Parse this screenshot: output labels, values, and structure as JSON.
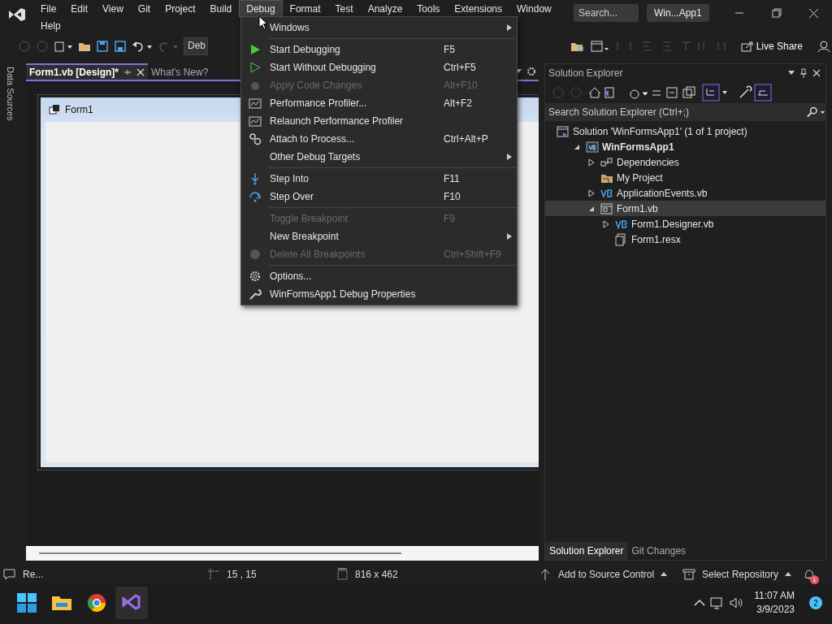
{
  "menu_bar": {
    "items": [
      {
        "label": "File",
        "selected": false
      },
      {
        "label": "Edit",
        "selected": false
      },
      {
        "label": "View",
        "selected": false
      },
      {
        "label": "Git",
        "selected": false
      },
      {
        "label": "Project",
        "selected": false
      },
      {
        "label": "Build",
        "selected": false
      },
      {
        "label": "Debug",
        "selected": true
      },
      {
        "label": "Format",
        "selected": false
      },
      {
        "label": "Test",
        "selected": false
      },
      {
        "label": "Analyze",
        "selected": false
      },
      {
        "label": "Tools",
        "selected": false
      },
      {
        "label": "Extensions",
        "selected": false
      },
      {
        "label": "Window",
        "selected": false
      },
      {
        "label": "Help",
        "selected": false
      }
    ],
    "search": {
      "placeholder": "Search..."
    },
    "solution_name": "Win...App1"
  },
  "toolbar": {
    "configuration": "Deb",
    "live_share": "Live Share"
  },
  "side_tab": "Data Sources",
  "doc_tabs": [
    {
      "label": "Form1.vb [Design]*",
      "selected": true
    },
    {
      "label": "What's New?",
      "selected": false
    }
  ],
  "designer": {
    "form_title": "Form1"
  },
  "debug_menu": [
    {
      "kind": "item",
      "label": "Windows",
      "disabled": false,
      "submenu": true
    },
    {
      "kind": "separator"
    },
    {
      "kind": "item",
      "label": "Start Debugging",
      "shortcut": "F5",
      "disabled": false,
      "submenu": false
    },
    {
      "kind": "item",
      "label": "Start Without Debugging",
      "shortcut": "Ctrl+F5",
      "disabled": false,
      "submenu": false
    },
    {
      "kind": "item",
      "label": "Apply Code Changes",
      "shortcut": "Alt+F10",
      "disabled": true,
      "submenu": false
    },
    {
      "kind": "item",
      "label": "Performance Profiler...",
      "shortcut": "Alt+F2",
      "disabled": false,
      "submenu": false
    },
    {
      "kind": "item",
      "label": "Relaunch Performance Profiler",
      "disabled": false,
      "submenu": false
    },
    {
      "kind": "item",
      "label": "Attach to Process...",
      "shortcut": "Ctrl+Alt+P",
      "disabled": false,
      "submenu": false
    },
    {
      "kind": "item",
      "label": "Other Debug Targets",
      "disabled": false,
      "submenu": true
    },
    {
      "kind": "separator"
    },
    {
      "kind": "item",
      "label": "Step Into",
      "shortcut": "F11",
      "disabled": false,
      "submenu": false
    },
    {
      "kind": "item",
      "label": "Step Over",
      "shortcut": "F10",
      "disabled": false,
      "submenu": false
    },
    {
      "kind": "separator"
    },
    {
      "kind": "item",
      "label": "Toggle Breakpoint",
      "shortcut": "F9",
      "disabled": true,
      "submenu": false
    },
    {
      "kind": "item",
      "label": "New Breakpoint",
      "disabled": false,
      "submenu": true
    },
    {
      "kind": "item",
      "label": "Delete All Breakpoints",
      "shortcut": "Ctrl+Shift+F9",
      "disabled": true,
      "submenu": false
    },
    {
      "kind": "separator"
    },
    {
      "kind": "item",
      "label": "Options...",
      "disabled": false,
      "submenu": false
    },
    {
      "kind": "item",
      "label": "WinFormsApp1 Debug Properties",
      "disabled": false,
      "submenu": false
    }
  ],
  "solution_explorer": {
    "title": "Solution Explorer",
    "search": {
      "placeholder": "Search Solution Explorer (Ctrl+;)"
    },
    "tree": [
      {
        "kind": "solution",
        "label": "Solution 'WinFormsApp1' (1 of 1 project)",
        "selected": false,
        "children": [
          {
            "kind": "project",
            "label": "WinFormsApp1",
            "expanded": true,
            "selected": false,
            "children": [
              {
                "kind": "dependencies",
                "label": "Dependencies",
                "expanded": false,
                "selected": false
              },
              {
                "kind": "myproject",
                "label": "My Project",
                "selected": false
              },
              {
                "kind": "vb",
                "label": "ApplicationEvents.vb",
                "expanded": false,
                "selected": false
              },
              {
                "kind": "form",
                "label": "Form1.vb",
                "expanded": true,
                "selected": true,
                "children": [
                  {
                    "kind": "vb",
                    "label": "Form1.Designer.vb",
                    "expanded": false,
                    "selected": false
                  },
                  {
                    "kind": "resx",
                    "label": "Form1.resx",
                    "selected": false
                  }
                ]
              }
            ]
          }
        ]
      }
    ],
    "tabs": [
      {
        "label": "Solution Explorer",
        "selected": true
      },
      {
        "label": "Git Changes",
        "selected": false
      }
    ]
  },
  "status_bar": {
    "message": "Re...",
    "position": "15 , 15",
    "size": "816 x 462",
    "source_control": "Add to Source Control",
    "repository": "Select Repository",
    "notifications": "1"
  },
  "taskbar": {
    "time": "11:07 AM",
    "date": "3/9/2023",
    "notification_count": "2"
  }
}
